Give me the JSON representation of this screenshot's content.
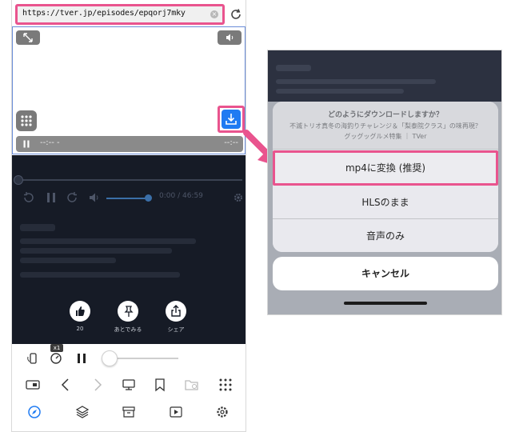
{
  "browser": {
    "url": "https://tver.jp/episodes/epqorj7mky",
    "clear_icon": "×"
  },
  "player": {
    "mini_time_left": "--:-- -",
    "mini_time_right": "--:--",
    "time_display": "0:00 / 46:59",
    "action_like_count": "20",
    "action_later_label": "あとでみる",
    "action_share_label": "シェア"
  },
  "toolbar": {
    "speed_label": "x1"
  },
  "download_sheet": {
    "title": "どのようにダウンロードしますか？",
    "message_line1": "不滅トリオ真冬の海釣りチャレンジ＆「梨泰院クラス」の味再現？",
    "message_line2": "グッグッグルメ特集 ｜ TVer",
    "option_mp4": "mp4に変換 (推奨)",
    "option_hls": "HLSのまま",
    "option_audio": "音声のみ",
    "cancel": "キャンセル"
  },
  "colors": {
    "highlight": "#e9548e",
    "download_button": "#1f7bf2",
    "toolbar_accent": "#1f7bf2"
  }
}
